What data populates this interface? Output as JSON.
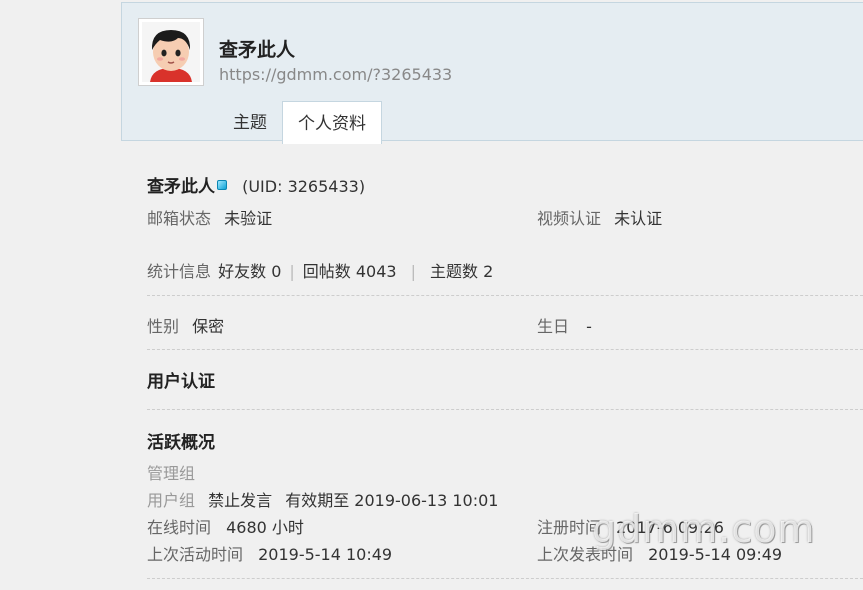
{
  "header": {
    "username": "查矛此人",
    "space_url": "https://gdmm.com/?3265433",
    "tabs": [
      {
        "label": "主题",
        "active": false
      },
      {
        "label": "个人资料",
        "active": true
      }
    ]
  },
  "profile": {
    "name": "查矛此人",
    "uid": "(UID: 3265433)",
    "email_status_label": "邮箱状态",
    "email_status_value": "未验证",
    "video_auth_label": "视频认证",
    "video_auth_value": "未认证",
    "stats_label": "统计信息",
    "friends": "好友数 0",
    "replies": "回帖数 4043",
    "threads": "主题数 2",
    "gender_label": "性别",
    "gender_value": "保密",
    "birthday_label": "生日",
    "birthday_value": "-"
  },
  "user_auth": {
    "title": "用户认证"
  },
  "activity": {
    "title": "活跃概况",
    "admin_group_label": "管理组",
    "user_group_label": "用户组",
    "user_group_value": "禁止发言",
    "valid_until": "有效期至 2019-06-13 10:01",
    "online_label": "在线时间",
    "online_value": "4680 小时",
    "register_label": "注册时间",
    "register_value": "2017-6 09:26",
    "last_active_label": "上次活动时间",
    "last_active_value": "2019-5-14 10:49",
    "last_post_label": "上次发表时间",
    "last_post_value": "2019-5-14 09:49"
  },
  "watermark": "gdmm.com",
  "colors": {
    "header_bg": "#e5edf2",
    "page_bg": "#f0f0f0",
    "accent_gem": "#0ea3d6"
  }
}
